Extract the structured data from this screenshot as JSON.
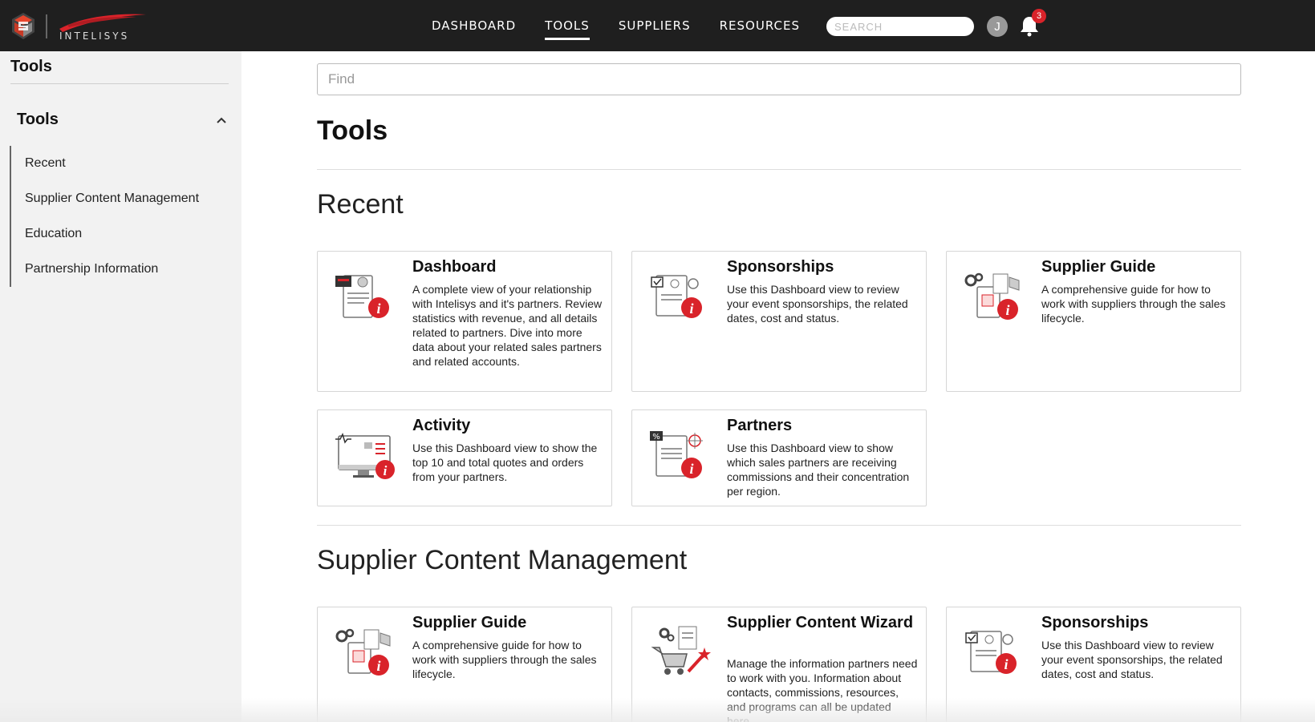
{
  "header": {
    "brand": "INTELISYS",
    "nav": [
      {
        "label": "DASHBOARD",
        "active": false
      },
      {
        "label": "TOOLS",
        "active": true
      },
      {
        "label": "SUPPLIERS",
        "active": false
      },
      {
        "label": "RESOURCES",
        "active": false
      }
    ],
    "search_placeholder": "SEARCH",
    "avatar_initial": "J",
    "notification_count": "3"
  },
  "sidebar": {
    "title": "Tools",
    "group_label": "Tools",
    "items": [
      "Recent",
      "Supplier Content Management",
      "Education",
      "Partnership Information"
    ]
  },
  "main": {
    "find_placeholder": "Find",
    "page_title": "Tools",
    "sections": [
      {
        "title": "Recent",
        "cards": [
          {
            "title": "Dashboard",
            "icon": "dashboard-info-icon",
            "description": "A complete view of your relationship with Intelisys and it's partners. Review statistics with revenue, and all details related to partners. Dive into more data about your related sales partners and related accounts."
          },
          {
            "title": "Sponsorships",
            "icon": "sponsorships-info-icon",
            "description": "Use this Dashboard view to review your event sponsorships, the related dates, cost and status."
          },
          {
            "title": "Supplier Guide",
            "icon": "supplier-guide-info-icon",
            "description": "A comprehensive guide for how to work with suppliers through the sales lifecycle."
          },
          {
            "title": "Activity",
            "icon": "activity-info-icon",
            "description": "Use this Dashboard view to show the top 10 and total quotes and orders from your partners."
          },
          {
            "title": "Partners",
            "icon": "partners-info-icon",
            "description": "Use this Dashboard view to show which sales partners are receiving commissions and their concentration per region."
          }
        ]
      },
      {
        "title": "Supplier Content Management",
        "cards": [
          {
            "title": "Supplier Guide",
            "icon": "supplier-guide-info-icon",
            "description": "A comprehensive guide for how to work with suppliers through the sales lifecycle."
          },
          {
            "title": "Supplier Content Wizard",
            "icon": "content-wizard-icon",
            "description": "Manage the information partners need to work with you. Information about contacts, commissions, resources, and programs can all be updated here."
          },
          {
            "title": "Sponsorships",
            "icon": "sponsorships-info-icon",
            "description": "Use this Dashboard view to review your event sponsorships, the related dates, cost and status."
          }
        ]
      }
    ]
  },
  "colors": {
    "topbar": "#1f1f1f",
    "accent_red": "#d9232a",
    "sidebar_bg": "#f2f2f2"
  }
}
